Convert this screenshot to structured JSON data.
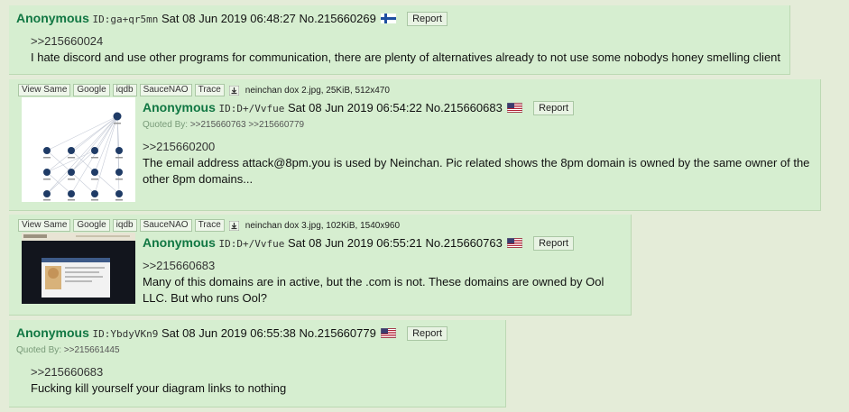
{
  "colors": {
    "name": "#117743",
    "post_bg": "#d6eed0",
    "page_bg": "#e4ecd8",
    "quote_link": "#333333"
  },
  "search_buttons": [
    "View Same",
    "Google",
    "iqdb",
    "SauceNAO",
    "Trace"
  ],
  "report_label": "Report",
  "quoted_by_label": "Quoted By:",
  "posts": [
    {
      "name": "Anonymous",
      "id": "ID:ga+qr5mn",
      "datetime": "Sat 08 Jun 2019 06:48:27",
      "num": "No.215660269",
      "flag": "Finland",
      "quote": ">>215660024",
      "text": "I hate discord and use other programs for communication, there are plenty of alternatives already to not use some nobodys honey smelling client"
    },
    {
      "file": "neinchan dox 2.jpg, 25KiB, 512x470",
      "name": "Anonymous",
      "id": "ID:D+/Vvfue",
      "datetime": "Sat 08 Jun 2019 06:54:22",
      "num": "No.215660683",
      "flag": "United States",
      "quoted_by": [
        ">>215660763",
        ">>215660779"
      ],
      "quote": ">>215660200",
      "text_lines": [
        "The email address attack@8pm.you is used by Neinchan. Pic related shows the 8pm domain is owned by the same owner of the",
        "other 8pm domains..."
      ]
    },
    {
      "file": "neinchan dox 3.jpg, 102KiB, 1540x960",
      "name": "Anonymous",
      "id": "ID:D+/Vvfue",
      "datetime": "Sat 08 Jun 2019 06:55:21",
      "num": "No.215660763",
      "flag": "United States",
      "quote": ">>215660683",
      "text_lines": [
        "Many of this domains are in active, but the .com is not. These domains are owned by Ool",
        "LLC. But who runs Ool?"
      ]
    },
    {
      "name": "Anonymous",
      "id": "ID:YbdyVKn9",
      "datetime": "Sat 08 Jun 2019 06:55:38",
      "num": "No.215660779",
      "flag": "United States",
      "quoted_by": [
        ">>215661445"
      ],
      "quote": ">>215660683",
      "text": "Fucking kill yourself your diagram links to nothing"
    }
  ]
}
